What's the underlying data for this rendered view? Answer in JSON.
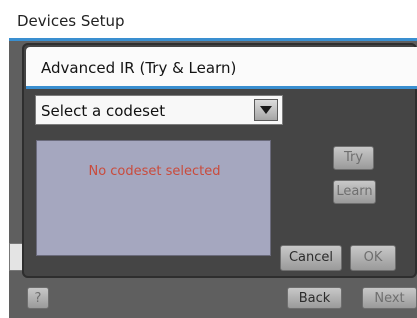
{
  "background": {
    "title": "Devices Setup",
    "help_label": "?",
    "back_label": "Back",
    "next_label": "Next"
  },
  "dialog": {
    "title": "Advanced IR (Try & Learn)",
    "codeset_select": {
      "value": "Select a codeset"
    },
    "empty_message": "No codeset selected",
    "try_label": "Try",
    "learn_label": "Learn",
    "cancel_label": "Cancel",
    "ok_label": "OK"
  },
  "colors": {
    "accent": "#3a8fd0",
    "panel": "#a5a7bf",
    "message": "#c94b3c"
  },
  "icons": [
    "dropdown-arrow-icon"
  ]
}
